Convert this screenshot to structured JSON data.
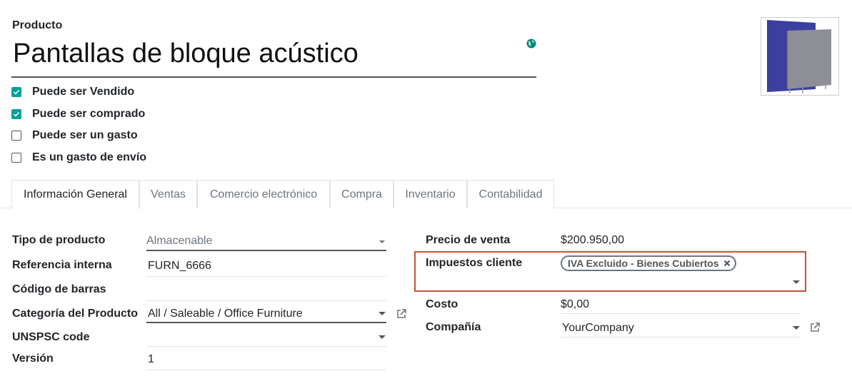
{
  "header": {
    "product_label": "Producto",
    "product_name": "Pantallas de bloque acústico"
  },
  "checkboxes": [
    {
      "label": "Puede ser Vendido",
      "checked": true
    },
    {
      "label": "Puede ser comprado",
      "checked": true
    },
    {
      "label": "Puede ser un gasto",
      "checked": false
    },
    {
      "label": "Es un gasto de envío",
      "checked": false
    }
  ],
  "tabs": [
    {
      "label": "Información General",
      "active": true
    },
    {
      "label": "Ventas",
      "active": false
    },
    {
      "label": "Comercio electrónico",
      "active": false
    },
    {
      "label": "Compra",
      "active": false
    },
    {
      "label": "Inventario",
      "active": false
    },
    {
      "label": "Contabilidad",
      "active": false
    }
  ],
  "left_fields": {
    "product_type": {
      "label": "Tipo de producto",
      "value": "Almacenable"
    },
    "internal_ref": {
      "label": "Referencia interna",
      "value": "FURN_6666"
    },
    "barcode": {
      "label": "Código de barras",
      "value": ""
    },
    "category": {
      "label": "Categoría del Producto",
      "value": "All / Saleable / Office Furniture"
    },
    "unspsc": {
      "label": "UNSPSC code",
      "value": ""
    },
    "version": {
      "label": "Versión",
      "value": "1"
    }
  },
  "right_fields": {
    "sale_price": {
      "label": "Precio de venta",
      "currency": "$",
      "value": "200.950,00"
    },
    "customer_taxes": {
      "label": "Impuestos cliente",
      "tag": "IVA Excluido - Bienes Cubiertos"
    },
    "cost": {
      "label": "Costo",
      "currency": "$",
      "value": "0,00"
    },
    "company": {
      "label": "Compañía",
      "value": "YourCompany"
    }
  },
  "colors": {
    "accent": "#00a09d",
    "highlight_border": "#c0553a",
    "image_blue": "#3a3fa0",
    "image_gray": "#8d8e96"
  }
}
